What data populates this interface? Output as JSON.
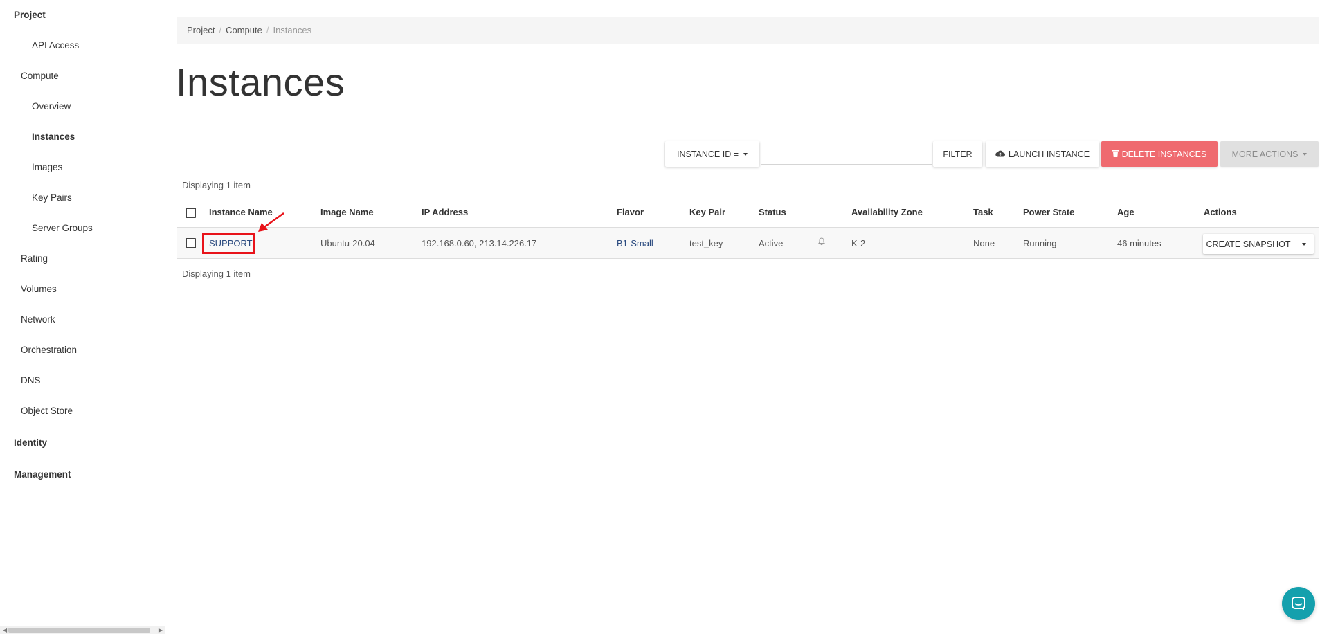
{
  "sidebar": {
    "project": "Project",
    "api_access": "API Access",
    "compute": "Compute",
    "overview": "Overview",
    "instances": "Instances",
    "images": "Images",
    "key_pairs": "Key Pairs",
    "server_groups": "Server Groups",
    "rating": "Rating",
    "volumes": "Volumes",
    "network": "Network",
    "orchestration": "Orchestration",
    "dns": "DNS",
    "object_store": "Object Store",
    "identity": "Identity",
    "management": "Management"
  },
  "breadcrumb": [
    "Project",
    "Compute",
    "Instances"
  ],
  "page_title": "Instances",
  "toolbar": {
    "filter_field": "INSTANCE ID =",
    "filter_value": "",
    "filter_button": "FILTER",
    "launch_button": "LAUNCH INSTANCE",
    "delete_button": "DELETE INSTANCES",
    "more_actions": "MORE ACTIONS"
  },
  "count_text": "Displaying 1 item",
  "table": {
    "columns": [
      "Instance Name",
      "Image Name",
      "IP Address",
      "Flavor",
      "Key Pair",
      "Status",
      "Availability Zone",
      "Task",
      "Power State",
      "Age",
      "Actions"
    ],
    "rows": [
      {
        "name": "SUPPORT",
        "image": "Ubuntu-20.04",
        "ip": "192.168.0.60, 213.14.226.17",
        "flavor": "B1-Small",
        "key_pair": "test_key",
        "status": "Active",
        "zone": "K-2",
        "task": "None",
        "power_state": "Running",
        "age": "46 minutes",
        "action": "CREATE SNAPSHOT"
      }
    ]
  },
  "colors": {
    "danger": "#ef6a6f",
    "link": "#2a4a7f",
    "highlight": "#e8131a",
    "chat": "#14a0ad"
  },
  "icons": {
    "launch": "cloud-upload-icon",
    "delete": "trash-icon",
    "status_bell": "bell-icon",
    "chat": "chat-icon"
  }
}
